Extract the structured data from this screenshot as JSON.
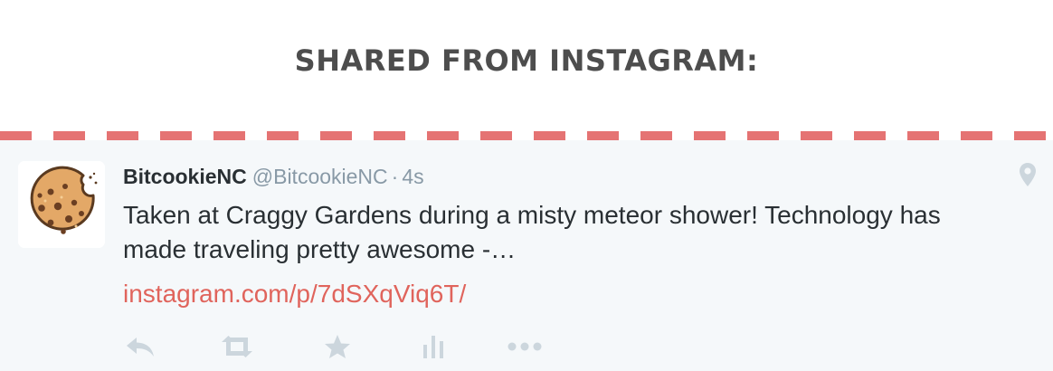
{
  "header": {
    "title": "SHARED FROM INSTAGRAM:"
  },
  "tweet": {
    "author_name": "BitcookieNC",
    "author_handle": "@BitcookieNC",
    "separator": "·",
    "timestamp": "4s",
    "text": "Taken at Craggy Gardens during a misty meteor shower! Technology has made traveling pretty awesome -…",
    "link": "instagram.com/p/7dSXqViq6T/",
    "avatar_icon": "cookie-icon",
    "location_icon": "map-pin-icon"
  },
  "actions": [
    {
      "name": "reply",
      "icon": "reply-icon"
    },
    {
      "name": "retweet",
      "icon": "retweet-icon"
    },
    {
      "name": "favorite",
      "icon": "star-icon"
    },
    {
      "name": "analytics",
      "icon": "bar-chart-icon"
    },
    {
      "name": "more",
      "icon": "more-dots-icon"
    }
  ],
  "colors": {
    "accent": "#e0645c",
    "divider": "#e57373",
    "tweet_background": "#f5f8fa",
    "muted": "#8899a6",
    "text": "#292f33",
    "icon": "#ccd6dd"
  }
}
